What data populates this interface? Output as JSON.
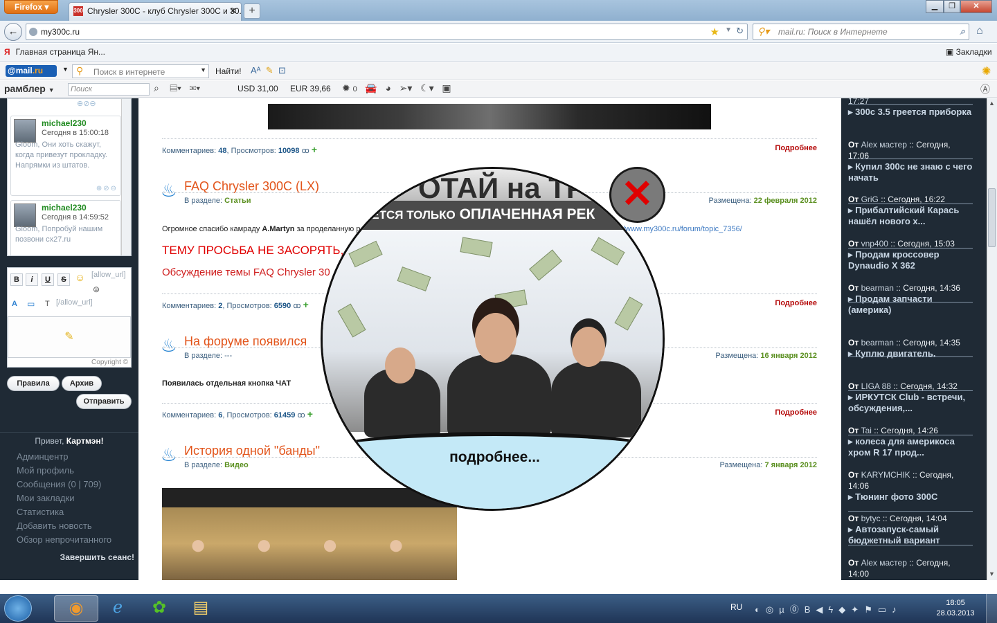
{
  "browser": {
    "app_button": "Firefox",
    "tab_title": "Chrysler 300C - клуб Chrysler 300C и 30...",
    "url": "my300c.ru",
    "search_placeholder": "mail.ru: Поиск в Интернете",
    "bookmark_left": "Главная страница Ян...",
    "bookmark_right": "Закладки"
  },
  "mail_toolbar": {
    "logo_prefix": "@mail",
    "logo_suffix": ".ru",
    "search_placeholder": "Поиск в интернете",
    "find_label": "Найти!"
  },
  "rambler_toolbar": {
    "logo": "рамблер",
    "search_placeholder": "Поиск",
    "usd": "USD 31,00",
    "eur": "EUR 39,66",
    "weather_count": "0"
  },
  "shoutbox": {
    "messages": [
      {
        "user": "michael230",
        "time": "Сегодня в 15:00:18",
        "text": "Gloom, Они хоть скажут, когда привезут прокладку. Напрямки из штатов."
      },
      {
        "user": "michael230",
        "time": "Сегодня в 14:59:52",
        "text": "Gloom, Попробуй нашим позвони cx27.ru"
      }
    ],
    "tag_open": "[allow_url]",
    "tag_close": "[/allow_url]",
    "copyright": "Copyright ©",
    "rules_button": "Правила",
    "archive_button": "Архив",
    "send_button": "Отправить"
  },
  "user_menu": {
    "greeting": "Привет,",
    "username": "Картмэн!",
    "items": [
      "Админцентр",
      "Мой профиль",
      "Сообщения (0 | 709)",
      "Мои закладки",
      "Статистика",
      "Добавить новость",
      "Обзор непрочитанного"
    ],
    "logout": "Завершить сеанс!"
  },
  "posts": [
    {
      "comments_label": "Комментариев:",
      "comments": "48",
      "views_label": "Просмотров:",
      "views": "10098",
      "more": "Подробнее"
    },
    {
      "title": "FAQ Chrysler 300C (LX)",
      "section_label": "В разделе:",
      "section": "Статьи",
      "date_label": "Размещена:",
      "date": "22 февраля 2012",
      "text_start": "Огромное спасибо камраду",
      "text_author": "A.Martyn",
      "text_rest": "за проделанную р",
      "link": "/www.my300c.ru/forum/topic_7356/",
      "red1": "ТЕМУ ПРОСЬБА НЕ ЗАСОРЯТЬ, П",
      "red2": "Обсуждение темы FAQ Chrysler 30",
      "comments_label": "Комментариев:",
      "comments": "2",
      "views_label": "Просмотров:",
      "views": "6590",
      "more": "Подробнее"
    },
    {
      "title": "На форуме появился",
      "section_label": "В разделе:",
      "section": "---",
      "date_label": "Размещена:",
      "date": "16 января 2012",
      "text": "Появилась отдельная кнопка ЧАТ",
      "comments_label": "Комментариев:",
      "comments": "6",
      "views_label": "Просмотров:",
      "views": "61459",
      "more": "Подробнее"
    },
    {
      "title": "История одной \"банды\"",
      "section_label": "В разделе:",
      "section": "Видео",
      "date_label": "Размещена:",
      "date": "7 января 2012"
    }
  ],
  "forum_feed": {
    "top_cut": "17:27",
    "items": [
      {
        "title": "300с 3.5 греется приборка"
      },
      {
        "from": "От",
        "author": "Alex мастер",
        "time": ":: Сегодня, 17:06",
        "title": "Купил 300с не знаю с чего начать"
      },
      {
        "from": "От",
        "author": "GriG",
        "time": ":: Сегодня, 16:22",
        "title": "Прибалтийский Карась нашёл нового х..."
      },
      {
        "from": "От",
        "author": "vnp400",
        "time": ":: Сегодня, 15:03",
        "title": "Продам кроссовер Dynaudio X 362"
      },
      {
        "from": "От",
        "author": "bearman",
        "time": ":: Сегодня, 14:36",
        "title": "Продам запчасти (америка)"
      },
      {
        "from": "От",
        "author": "bearman",
        "time": ":: Сегодня, 14:35",
        "title": "Куплю двигатель."
      },
      {
        "from": "От",
        "author": "LIGA 88",
        "time": ":: Сегодня, 14:32",
        "title": "ИРКУТСК Club - встречи, обсуждения,..."
      },
      {
        "from": "От",
        "author": "Tai",
        "time": ":: Сегодня, 14:26",
        "title": "колеса для америкоса хром R 17 прод..."
      },
      {
        "from": "От",
        "author": "KARYMCHIK",
        "time": ":: Сегодня, 14:06",
        "title": "Тюнинг фото 300С"
      },
      {
        "from": "От",
        "author": "bytyc",
        "time": ":: Сегодня, 14:04",
        "title": "Автозапуск-самый бюджетный вариант"
      },
      {
        "from": "От",
        "author": "Alex мастер",
        "time": ":: Сегодня, 14:00"
      }
    ]
  },
  "popup_ad": {
    "headline": "ОТАЙ на ТР",
    "subline_small": "АЕТСЯ ТОЛЬКО",
    "subline_big": "ОПЛАЧЕННАЯ РЕК",
    "cta": "подробнее...",
    "close_glyph": "✕"
  },
  "taskbar": {
    "lang": "RU",
    "time": "18:05",
    "date": "28.03.2013"
  },
  "colors": {
    "sidebar_bg": "#1f2a35",
    "post_title": "#e2541a",
    "more_link": "#b50a0a",
    "date_green": "#5a8f1f",
    "ad_close_red": "#e00000"
  }
}
